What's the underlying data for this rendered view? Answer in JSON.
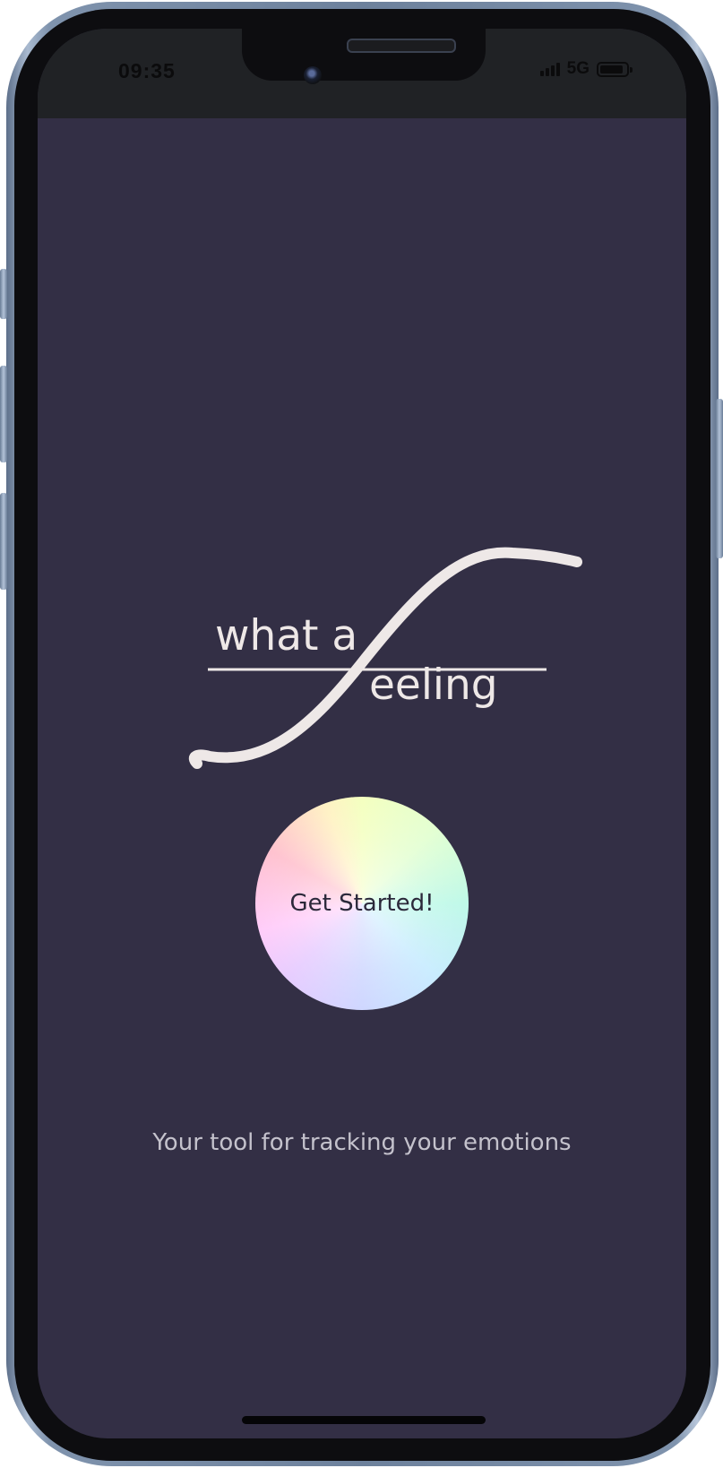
{
  "status_bar": {
    "time": "09:35",
    "network": "5G",
    "icons": [
      "signal-icon",
      "battery-icon"
    ]
  },
  "logo": {
    "line1": "what a",
    "line2": "eeling"
  },
  "main": {
    "start_button_label": "Get Started!",
    "tagline": "Your tool for tracking your emotions"
  },
  "colors": {
    "background": "#332f45",
    "status_bar": "#202225",
    "logo": "#eee8e7",
    "tagline": "#c4c2cc",
    "button_text": "#2b283a"
  }
}
